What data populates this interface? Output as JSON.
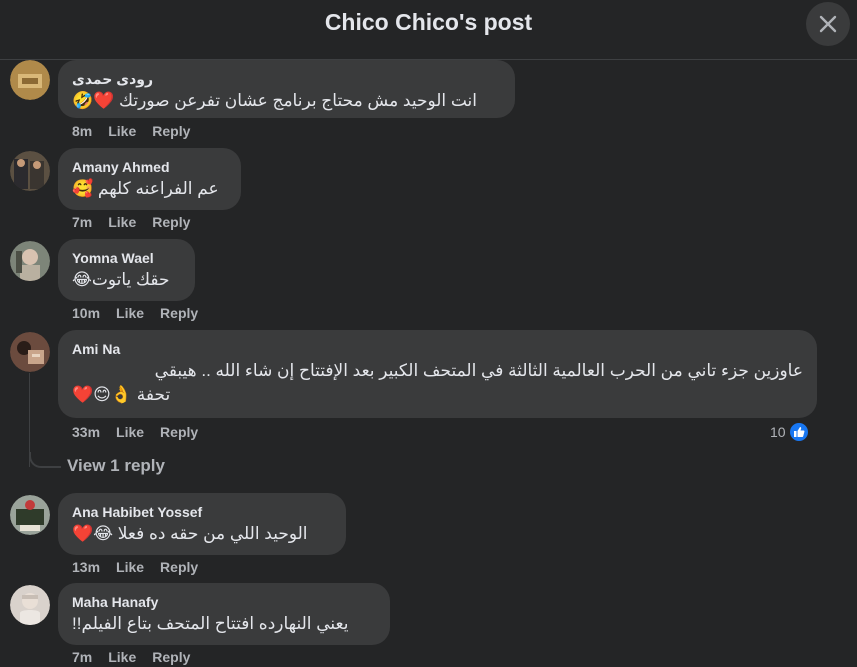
{
  "header": {
    "title": "Chico Chico's post"
  },
  "comments": [
    {
      "author": "رودى حمدى",
      "text": "انت الوحيد مش محتاج برنامج عشان تفرعن صورتك ❤️🤣",
      "time": "8m",
      "like": "Like",
      "reply": "Reply"
    },
    {
      "author": "Amany Ahmed",
      "text": "عم الفراعنه كلهم 🥰",
      "time": "7m",
      "like": "Like",
      "reply": "Reply"
    },
    {
      "author": "Yomna Wael",
      "text": "حقك ياتوت😂",
      "time": "10m",
      "like": "Like",
      "reply": "Reply"
    },
    {
      "author": "Ami Na",
      "text_line1": "عاوزين جزء تاني من الحرب العالمية الثالثة في المتحف الكبير بعد الإفتتاح إن شاء الله .. هيبقي",
      "text_line2": "تحفة 👌😊❤️",
      "time": "33m",
      "like": "Like",
      "reply": "Reply",
      "reaction_count": "10",
      "view_replies": "View 1 reply"
    },
    {
      "author": "Ana Habibet Yossef",
      "text": "الوحيد اللي من حقه ده فعلا 😂❤️",
      "time": "13m",
      "like": "Like",
      "reply": "Reply"
    },
    {
      "author": "Maha Hanafy",
      "text": "يعني النهارده افتتاح المتحف بتاع الفيلم!!",
      "time": "7m",
      "like": "Like",
      "reply": "Reply"
    }
  ],
  "colors": {
    "background": "#242526",
    "bubble": "#3a3b3c",
    "like_blue": "#1877f2"
  }
}
